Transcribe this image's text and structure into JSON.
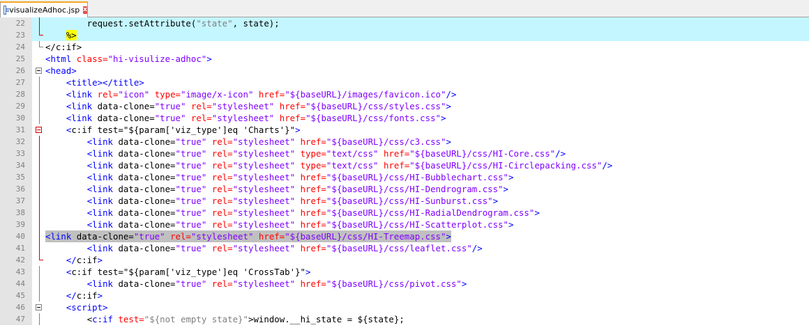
{
  "tab": {
    "filename": "visualizeAdhoc.jsp",
    "close_glyph": "x",
    "active_color": "#f5a623"
  },
  "colors": {
    "tag": "#0000ff",
    "attribute": "#ff0000",
    "value": "#8000ff",
    "text": "#000000",
    "highlight": "#c4f6ff",
    "selection": "#c0c0c0",
    "gutter": "#e4e4e4"
  },
  "editor": {
    "lines": [
      {
        "n": "22",
        "hl": true,
        "fold": "line-red",
        "sel": false,
        "tokens": [
          [
            "j",
            "        request.setAttribute("
          ],
          [
            "js",
            "\"state\""
          ],
          [
            "j",
            ", state);"
          ]
        ]
      },
      {
        "n": "23",
        "hl": true,
        "fold": "end-red",
        "sel": false,
        "tokens": [
          [
            "p",
            "    "
          ],
          [
            "jsp",
            "%>"
          ]
        ]
      },
      {
        "n": "24",
        "hl": false,
        "fold": "end",
        "sel": false,
        "tokens": [
          [
            "p",
            "</c:if>"
          ]
        ]
      },
      {
        "n": "25",
        "hl": false,
        "fold": "",
        "sel": false,
        "tokens": [
          [
            "t",
            "<html "
          ],
          [
            "a",
            "class="
          ],
          [
            "s",
            "\"hi-visulize-adhoc\""
          ],
          [
            "t",
            ">"
          ]
        ]
      },
      {
        "n": "26",
        "hl": false,
        "fold": "box",
        "sel": false,
        "tokens": [
          [
            "t",
            "<head>"
          ]
        ]
      },
      {
        "n": "27",
        "hl": false,
        "fold": "line",
        "sel": false,
        "tokens": [
          [
            "p",
            "    "
          ],
          [
            "t",
            "<title></title>"
          ]
        ]
      },
      {
        "n": "28",
        "hl": false,
        "fold": "line",
        "sel": false,
        "tokens": [
          [
            "p",
            "    "
          ],
          [
            "t",
            "<link "
          ],
          [
            "a",
            "rel="
          ],
          [
            "s",
            "\"icon\""
          ],
          [
            "p",
            " "
          ],
          [
            "a",
            "type="
          ],
          [
            "s",
            "\"image/x-icon\""
          ],
          [
            "p",
            " "
          ],
          [
            "a",
            "href="
          ],
          [
            "s",
            "\"${baseURL}/images/favicon.ico\""
          ],
          [
            "t",
            "/>"
          ]
        ]
      },
      {
        "n": "29",
        "hl": false,
        "fold": "line",
        "sel": false,
        "tokens": [
          [
            "p",
            "    "
          ],
          [
            "t",
            "<link "
          ],
          [
            "p",
            "data-clone="
          ],
          [
            "s",
            "\"true\""
          ],
          [
            "p",
            " "
          ],
          [
            "a",
            "rel="
          ],
          [
            "s",
            "\"stylesheet\""
          ],
          [
            "p",
            " "
          ],
          [
            "a",
            "href="
          ],
          [
            "s",
            "\"${baseURL}/css/styles.css\""
          ],
          [
            "t",
            ">"
          ]
        ]
      },
      {
        "n": "30",
        "hl": false,
        "fold": "line",
        "sel": false,
        "tokens": [
          [
            "p",
            "    "
          ],
          [
            "t",
            "<link "
          ],
          [
            "p",
            "data-clone="
          ],
          [
            "s",
            "\"true\""
          ],
          [
            "p",
            " "
          ],
          [
            "a",
            "rel="
          ],
          [
            "s",
            "\"stylesheet\""
          ],
          [
            "p",
            " "
          ],
          [
            "a",
            "href="
          ],
          [
            "s",
            "\"${baseURL}/css/fonts.css\""
          ],
          [
            "t",
            ">"
          ]
        ]
      },
      {
        "n": "31",
        "hl": false,
        "fold": "box-red",
        "sel": false,
        "tokens": [
          [
            "p",
            "    "
          ],
          [
            "t",
            "<"
          ],
          [
            "p",
            "c:if test=\"${param['viz_type']eq 'Charts'}\""
          ],
          [
            "t",
            ">"
          ]
        ]
      },
      {
        "n": "32",
        "hl": false,
        "fold": "line-red",
        "sel": false,
        "tokens": [
          [
            "p",
            "        "
          ],
          [
            "t",
            "<link "
          ],
          [
            "p",
            "data-clone="
          ],
          [
            "s",
            "\"true\""
          ],
          [
            "p",
            " "
          ],
          [
            "a",
            "rel="
          ],
          [
            "s",
            "\"stylesheet\""
          ],
          [
            "p",
            " "
          ],
          [
            "a",
            "href="
          ],
          [
            "s",
            "\"${baseURL}/css/c3.css\""
          ],
          [
            "t",
            ">"
          ]
        ]
      },
      {
        "n": "33",
        "hl": false,
        "fold": "line-red",
        "sel": false,
        "tokens": [
          [
            "p",
            "        "
          ],
          [
            "t",
            "<link "
          ],
          [
            "p",
            "data-clone="
          ],
          [
            "s",
            "\"true\""
          ],
          [
            "p",
            " "
          ],
          [
            "a",
            "rel="
          ],
          [
            "s",
            "\"stylesheet\""
          ],
          [
            "p",
            " "
          ],
          [
            "a",
            "type="
          ],
          [
            "s",
            "\"text/css\""
          ],
          [
            "p",
            " "
          ],
          [
            "a",
            "href="
          ],
          [
            "s",
            "\"${baseURL}/css/HI-Core.css\""
          ],
          [
            "t",
            "/>"
          ]
        ]
      },
      {
        "n": "34",
        "hl": false,
        "fold": "line-red",
        "sel": false,
        "tokens": [
          [
            "p",
            "        "
          ],
          [
            "t",
            "<link "
          ],
          [
            "p",
            "data-clone="
          ],
          [
            "s",
            "\"true\""
          ],
          [
            "p",
            " "
          ],
          [
            "a",
            "rel="
          ],
          [
            "s",
            "\"stylesheet\""
          ],
          [
            "p",
            " "
          ],
          [
            "a",
            "type="
          ],
          [
            "s",
            "\"text/css\""
          ],
          [
            "p",
            " "
          ],
          [
            "a",
            "href="
          ],
          [
            "s",
            "\"${baseURL}/css/HI-Circlepacking.css\""
          ],
          [
            "t",
            "/>"
          ]
        ]
      },
      {
        "n": "35",
        "hl": false,
        "fold": "line-red",
        "sel": false,
        "tokens": [
          [
            "p",
            "        "
          ],
          [
            "t",
            "<link "
          ],
          [
            "p",
            "data-clone="
          ],
          [
            "s",
            "\"true\""
          ],
          [
            "p",
            " "
          ],
          [
            "a",
            "rel="
          ],
          [
            "s",
            "\"stylesheet\""
          ],
          [
            "p",
            " "
          ],
          [
            "a",
            "href="
          ],
          [
            "s",
            "\"${baseURL}/css/HI-Bubblechart.css\""
          ],
          [
            "t",
            ">"
          ]
        ]
      },
      {
        "n": "36",
        "hl": false,
        "fold": "line-red",
        "sel": false,
        "tokens": [
          [
            "p",
            "        "
          ],
          [
            "t",
            "<link "
          ],
          [
            "p",
            "data-clone="
          ],
          [
            "s",
            "\"true\""
          ],
          [
            "p",
            " "
          ],
          [
            "a",
            "rel="
          ],
          [
            "s",
            "\"stylesheet\""
          ],
          [
            "p",
            " "
          ],
          [
            "a",
            "href="
          ],
          [
            "s",
            "\"${baseURL}/css/HI-Dendrogram.css\""
          ],
          [
            "t",
            ">"
          ]
        ]
      },
      {
        "n": "37",
        "hl": false,
        "fold": "line-red",
        "sel": false,
        "tokens": [
          [
            "p",
            "        "
          ],
          [
            "t",
            "<link "
          ],
          [
            "p",
            "data-clone="
          ],
          [
            "s",
            "\"true\""
          ],
          [
            "p",
            " "
          ],
          [
            "a",
            "rel="
          ],
          [
            "s",
            "\"stylesheet\""
          ],
          [
            "p",
            " "
          ],
          [
            "a",
            "href="
          ],
          [
            "s",
            "\"${baseURL}/css/HI-Sunburst.css\""
          ],
          [
            "t",
            ">"
          ]
        ]
      },
      {
        "n": "38",
        "hl": false,
        "fold": "line-red",
        "sel": false,
        "tokens": [
          [
            "p",
            "        "
          ],
          [
            "t",
            "<link "
          ],
          [
            "p",
            "data-clone="
          ],
          [
            "s",
            "\"true\""
          ],
          [
            "p",
            " "
          ],
          [
            "a",
            "rel="
          ],
          [
            "s",
            "\"stylesheet\""
          ],
          [
            "p",
            " "
          ],
          [
            "a",
            "href="
          ],
          [
            "s",
            "\"${baseURL}/css/HI-RadialDendrogram.css\""
          ],
          [
            "t",
            ">"
          ]
        ]
      },
      {
        "n": "39",
        "hl": false,
        "fold": "line-red",
        "sel": false,
        "tokens": [
          [
            "p",
            "        "
          ],
          [
            "t",
            "<link "
          ],
          [
            "p",
            "data-clone="
          ],
          [
            "s",
            "\"true\""
          ],
          [
            "p",
            " "
          ],
          [
            "a",
            "rel="
          ],
          [
            "s",
            "\"stylesheet\""
          ],
          [
            "p",
            " "
          ],
          [
            "a",
            "href="
          ],
          [
            "s",
            "\"${baseURL}/css/HI-Scatterplot.css\""
          ],
          [
            "t",
            ">"
          ]
        ]
      },
      {
        "n": "40",
        "hl": false,
        "fold": "line-red",
        "sel": true,
        "tokens": [
          [
            "t",
            "<link "
          ],
          [
            "p",
            "data-clone="
          ],
          [
            "s",
            "\"true\""
          ],
          [
            "p",
            " "
          ],
          [
            "a",
            "rel="
          ],
          [
            "s",
            "\"stylesheet\""
          ],
          [
            "p",
            " "
          ],
          [
            "a",
            "href="
          ],
          [
            "s",
            "\"${baseURL}/css/HI-Treemap.css\""
          ],
          [
            "t",
            ">"
          ]
        ]
      },
      {
        "n": "41",
        "hl": false,
        "fold": "line-red",
        "sel": false,
        "tokens": [
          [
            "p",
            "        "
          ],
          [
            "t",
            "<link "
          ],
          [
            "p",
            "data-clone="
          ],
          [
            "s",
            "\"true\""
          ],
          [
            "p",
            " "
          ],
          [
            "a",
            "rel="
          ],
          [
            "s",
            "\"stylesheet\""
          ],
          [
            "p",
            " "
          ],
          [
            "a",
            "href="
          ],
          [
            "s",
            "\"${baseURL}/css/leaflet.css\""
          ],
          [
            "t",
            "/>"
          ]
        ]
      },
      {
        "n": "42",
        "hl": false,
        "fold": "end-red",
        "sel": false,
        "tokens": [
          [
            "p",
            "    "
          ],
          [
            "t",
            "</"
          ],
          [
            "p",
            "c:if"
          ],
          [
            "t",
            ">"
          ]
        ]
      },
      {
        "n": "43",
        "hl": false,
        "fold": "line",
        "sel": false,
        "tokens": [
          [
            "p",
            "    "
          ],
          [
            "t",
            "<"
          ],
          [
            "p",
            "c:if test=\"${param['viz_type']eq 'CrossTab'}\""
          ],
          [
            "t",
            ">"
          ]
        ]
      },
      {
        "n": "44",
        "hl": false,
        "fold": "line",
        "sel": false,
        "tokens": [
          [
            "p",
            "        "
          ],
          [
            "t",
            "<link "
          ],
          [
            "p",
            "data-clone="
          ],
          [
            "s",
            "\"true\""
          ],
          [
            "p",
            " "
          ],
          [
            "a",
            "rel="
          ],
          [
            "s",
            "\"stylesheet\""
          ],
          [
            "p",
            " "
          ],
          [
            "a",
            "href="
          ],
          [
            "s",
            "\"${baseURL}/css/pivot.css\""
          ],
          [
            "t",
            ">"
          ]
        ]
      },
      {
        "n": "45",
        "hl": false,
        "fold": "line",
        "sel": false,
        "tokens": [
          [
            "p",
            "    "
          ],
          [
            "t",
            "</"
          ],
          [
            "p",
            "c:if"
          ],
          [
            "t",
            ">"
          ]
        ]
      },
      {
        "n": "46",
        "hl": false,
        "fold": "box",
        "sel": false,
        "tokens": [
          [
            "p",
            "    "
          ],
          [
            "t",
            "<script>"
          ]
        ]
      },
      {
        "n": "47",
        "hl": false,
        "fold": "line",
        "sel": false,
        "tokens": [
          [
            "p",
            "        "
          ],
          [
            "j",
            "<"
          ],
          [
            "jk",
            "c:if "
          ],
          [
            "a",
            "test="
          ],
          [
            "js",
            "\"${not empty state}\""
          ],
          [
            "j",
            ">window.__hi_state = ${state};"
          ]
        ]
      }
    ]
  }
}
